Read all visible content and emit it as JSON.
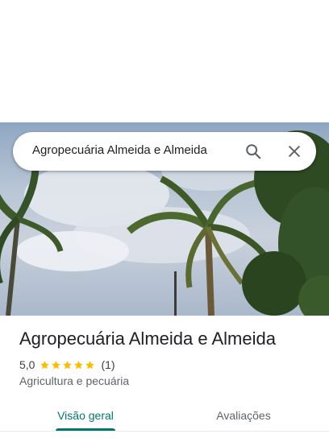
{
  "search": {
    "query": "Agropecuária Almeida e Almeida",
    "search_icon": "search-icon",
    "close_icon": "close-icon"
  },
  "place": {
    "name": "Agropecuária Almeida e Almeida",
    "rating_value": "5,0",
    "stars_filled": 5,
    "stars_total": 5,
    "review_count": "(1)",
    "category": "Agricultura e pecuária"
  },
  "tabs": [
    {
      "label": "Visão geral",
      "active": true
    },
    {
      "label": "Avaliações",
      "active": false
    }
  ],
  "colors": {
    "accent": "#00796b",
    "star": "#fbbc04",
    "text_primary": "#202124",
    "text_secondary": "#5f6368"
  }
}
